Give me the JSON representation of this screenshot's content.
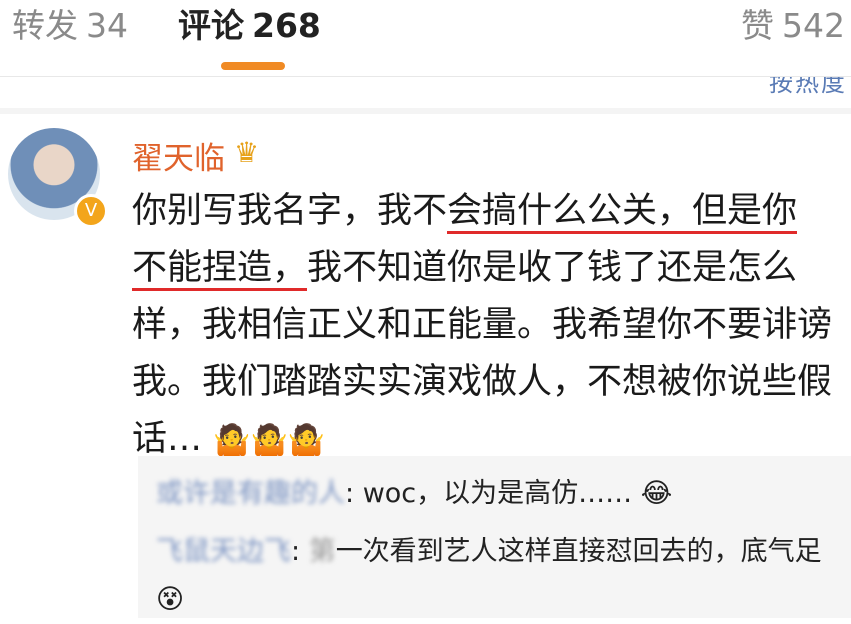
{
  "tabs": [
    {
      "label": "转发",
      "count": "34"
    },
    {
      "label": "评论",
      "count": "268"
    },
    {
      "label": "赞",
      "count": "542"
    }
  ],
  "sort": {
    "label": "按热度"
  },
  "comment": {
    "username": "翟天临",
    "crown_icon": "crown-icon",
    "text_part1": "你别写我名字，我不",
    "text_highlight1": "会搞什么公关，但是你不能捏造，",
    "text_part2": "我不知道你是收了钱了还是怎么样，我相信正义和正能量。我希望你不要诽谤我。我们踏踏实实演戏做人，不想被你说些假话…",
    "emojis": "🤷🤷🤷",
    "verified_badge": "V"
  },
  "replies": [
    {
      "author": "或许是有趣的人",
      "sep": ": ",
      "text": "woc，以为是高仿……",
      "emoji": "😂"
    },
    {
      "author": "飞鼠天边飞",
      "sep": ": ",
      "text_blur": "第",
      "text": "一次看到艺人这样直接怼回去的，底气足",
      "emoji": "😵"
    }
  ]
}
